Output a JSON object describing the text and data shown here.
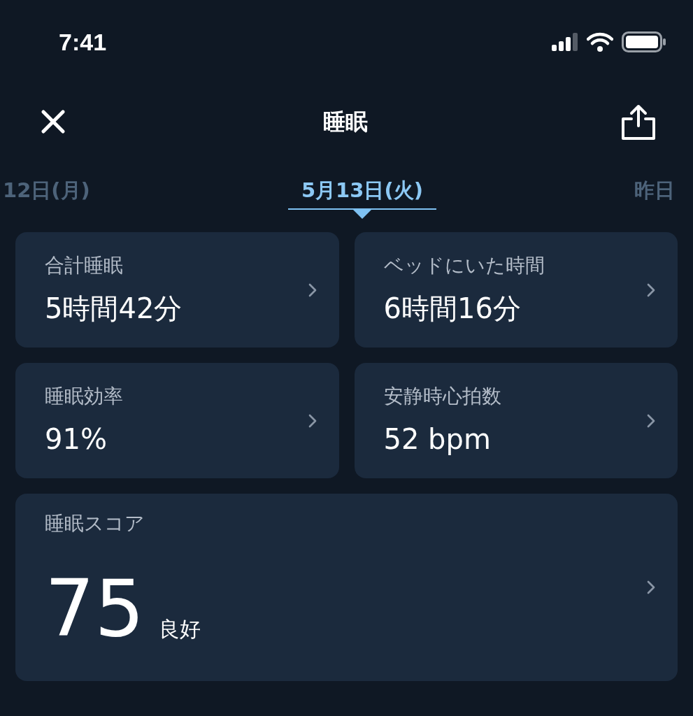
{
  "status_bar": {
    "time": "7:41"
  },
  "header": {
    "title": "睡眠"
  },
  "date_tabs": [
    {
      "label": "12日(月)",
      "selected": false
    },
    {
      "label": "5月13日(火)",
      "selected": true
    },
    {
      "label": "昨日",
      "selected": false
    }
  ],
  "metrics": [
    {
      "label": "合計睡眠",
      "value": "5時間42分"
    },
    {
      "label": "ベッドにいた時間",
      "value": "6時間16分"
    },
    {
      "label": "睡眠効率",
      "value": "91%"
    },
    {
      "label": "安静時心拍数",
      "value": "52 bpm"
    }
  ],
  "score": {
    "label": "睡眠スコア",
    "value": "75",
    "rating": "良好"
  }
}
